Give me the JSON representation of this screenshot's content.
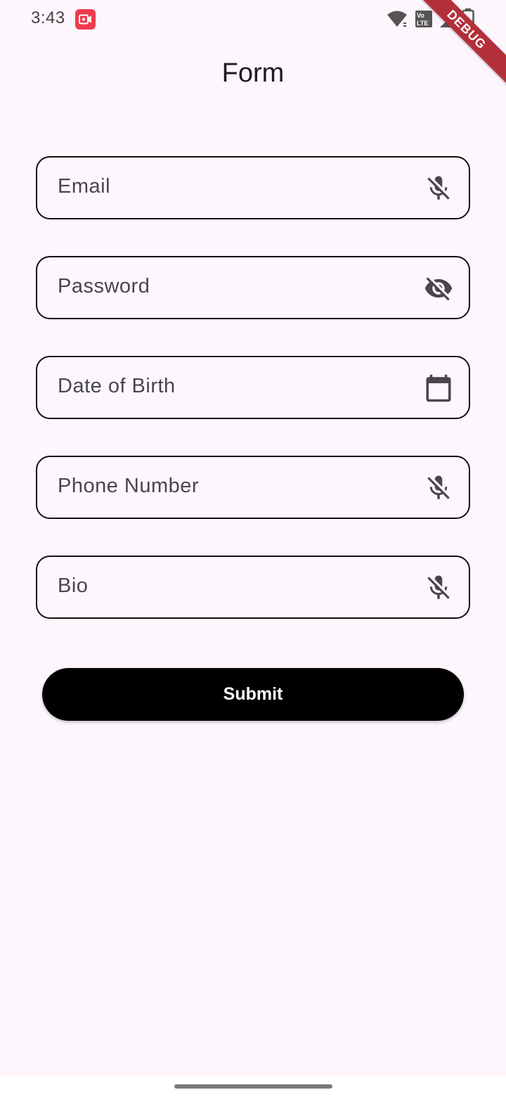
{
  "status_bar": {
    "time": "3:43",
    "icons": [
      "screen-record-icon",
      "wifi-icon",
      "volte-icon",
      "cell-signal-icon",
      "battery-icon"
    ]
  },
  "debug_banner": {
    "label": "DEBUG",
    "color": "#b3303b"
  },
  "app_bar": {
    "title": "Form"
  },
  "form": {
    "fields": [
      {
        "label": "Email",
        "icon": "mic-off-icon"
      },
      {
        "label": "Password",
        "icon": "visibility-off-icon"
      },
      {
        "label": "Date of Birth",
        "icon": "calendar-icon"
      },
      {
        "label": "Phone Number",
        "icon": "mic-off-icon"
      },
      {
        "label": "Bio",
        "icon": "mic-off-icon"
      }
    ],
    "submit_label": "Submit"
  },
  "colors": {
    "background": "#fdf6fd",
    "button": "#000000",
    "button_text": "#ffffff",
    "field_border": "#111111",
    "label_text": "#48454e"
  }
}
